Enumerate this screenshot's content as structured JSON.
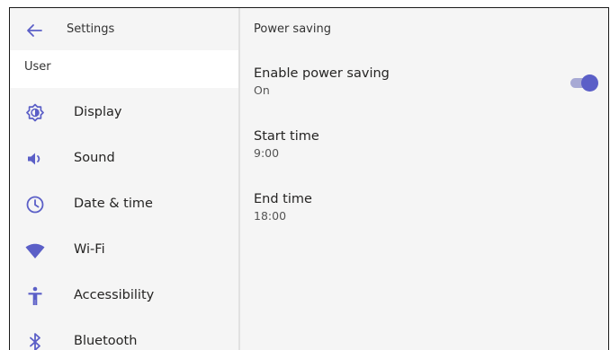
{
  "header": {
    "title": "Settings"
  },
  "sidebar": {
    "section": "User",
    "items": [
      {
        "label": "Display",
        "icon": "display-icon"
      },
      {
        "label": "Sound",
        "icon": "sound-icon"
      },
      {
        "label": "Date & time",
        "icon": "clock-icon"
      },
      {
        "label": "Wi-Fi",
        "icon": "wifi-icon"
      },
      {
        "label": "Accessibility",
        "icon": "accessibility-icon"
      },
      {
        "label": "Bluetooth",
        "icon": "bluetooth-icon"
      }
    ]
  },
  "main": {
    "title": "Power saving",
    "settings": [
      {
        "title": "Enable power saving",
        "value": "On"
      },
      {
        "title": "Start time",
        "value": "9:00"
      },
      {
        "title": "End time",
        "value": "18:00"
      }
    ],
    "toggle": {
      "on": true
    }
  },
  "colors": {
    "accent": "#5b5fc7",
    "accent_light": "#a7a9d4",
    "background": "#f5f5f5",
    "selected": "#ffffff"
  }
}
